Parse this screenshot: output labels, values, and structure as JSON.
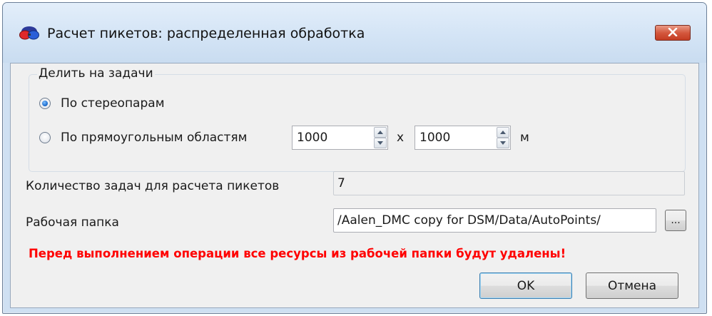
{
  "window": {
    "title": "Расчет пикетов: распределенная обработка",
    "icon": "stereo-glasses-icon",
    "close_icon": "close-icon"
  },
  "group": {
    "legend": "Делить на задачи",
    "option_stereopairs": {
      "label": "По стереопарам",
      "selected": true
    },
    "option_rectangles": {
      "label": "По прямоугольным областям",
      "selected": false,
      "width_value": "1000",
      "times_label": "х",
      "height_value": "1000",
      "unit": "м"
    }
  },
  "tasks": {
    "label": "Количество задач для расчета пикетов",
    "value": "7"
  },
  "workdir": {
    "label": "Рабочая папка",
    "value": "/Aalen_DMC copy for DSM/Data/AutoPoints/",
    "browse_label": "..."
  },
  "warning": "Перед выполнением операции все ресурсы из рабочей папки будут удалены!",
  "buttons": {
    "ok": "OK",
    "cancel": "Отмена"
  },
  "colors": {
    "warning": "#ff0000",
    "close_button": "#c43c22",
    "frame": "#cfe0f2"
  }
}
